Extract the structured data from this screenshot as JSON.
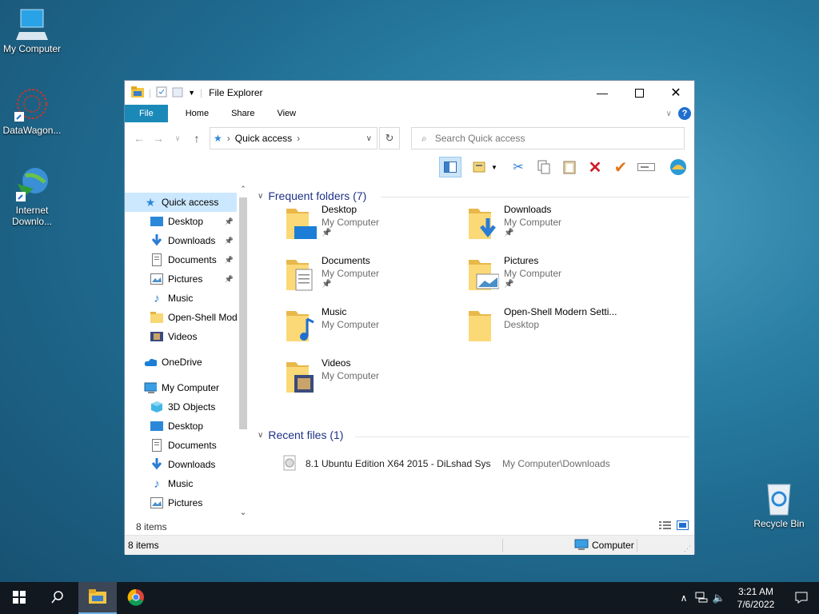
{
  "desktop": {
    "icons": [
      {
        "label": "My Computer"
      },
      {
        "label": "DataWagon..."
      },
      {
        "label": "Internet Downlo..."
      },
      {
        "label": "Recycle Bin"
      }
    ]
  },
  "window": {
    "title": "File Explorer",
    "tabs": [
      "File",
      "Home",
      "Share",
      "View"
    ],
    "address": {
      "label": "Quick access"
    },
    "search": {
      "placeholder": "Search Quick access"
    },
    "nav_pane": {
      "items": [
        {
          "label": "Quick access",
          "icon": "star-icon",
          "pinned": false
        },
        {
          "label": "Desktop",
          "icon": "desktop-icon",
          "pinned": true
        },
        {
          "label": "Downloads",
          "icon": "download-icon",
          "pinned": true
        },
        {
          "label": "Documents",
          "icon": "document-icon",
          "pinned": true
        },
        {
          "label": "Pictures",
          "icon": "picture-icon",
          "pinned": true
        },
        {
          "label": "Music",
          "icon": "music-icon",
          "pinned": false
        },
        {
          "label": "Open-Shell Mod",
          "icon": "folder-icon",
          "pinned": false
        },
        {
          "label": "Videos",
          "icon": "video-icon",
          "pinned": false
        },
        {
          "label": "OneDrive",
          "icon": "cloud-icon",
          "pinned": false
        },
        {
          "label": "My Computer",
          "icon": "computer-icon",
          "pinned": false
        },
        {
          "label": "3D Objects",
          "icon": "cube-icon",
          "pinned": false
        },
        {
          "label": "Desktop",
          "icon": "desktop-icon",
          "pinned": false
        },
        {
          "label": "Documents",
          "icon": "document-icon",
          "pinned": false
        },
        {
          "label": "Downloads",
          "icon": "download-icon",
          "pinned": false
        },
        {
          "label": "Music",
          "icon": "music-icon",
          "pinned": false
        },
        {
          "label": "Pictures",
          "icon": "picture-icon",
          "pinned": false
        }
      ]
    },
    "frequent": {
      "header": "Frequent folders (7)",
      "folders": [
        {
          "name": "Desktop",
          "location": "My Computer",
          "pinned": true
        },
        {
          "name": "Downloads",
          "location": "My Computer",
          "pinned": true
        },
        {
          "name": "Documents",
          "location": "My Computer",
          "pinned": true
        },
        {
          "name": "Pictures",
          "location": "My Computer",
          "pinned": true
        },
        {
          "name": "Music",
          "location": "My Computer",
          "pinned": false
        },
        {
          "name": "Open-Shell Modern Setti...",
          "location": "Desktop",
          "pinned": false
        },
        {
          "name": "Videos",
          "location": "My Computer",
          "pinned": false
        }
      ]
    },
    "recent": {
      "header": "Recent files (1)",
      "files": [
        {
          "name": "8.1 Ubuntu Edition X64 2015 - DiLshad Sys",
          "path": "My Computer\\Downloads"
        }
      ]
    },
    "item_count": "8 items",
    "status": {
      "left": "8 items",
      "right": "Computer"
    }
  },
  "taskbar": {
    "time": "3:21 AM",
    "date": "7/6/2022"
  },
  "colors": {
    "accent": "#1a89b8",
    "group_header": "#1e3287",
    "taskbar": "#111820"
  }
}
